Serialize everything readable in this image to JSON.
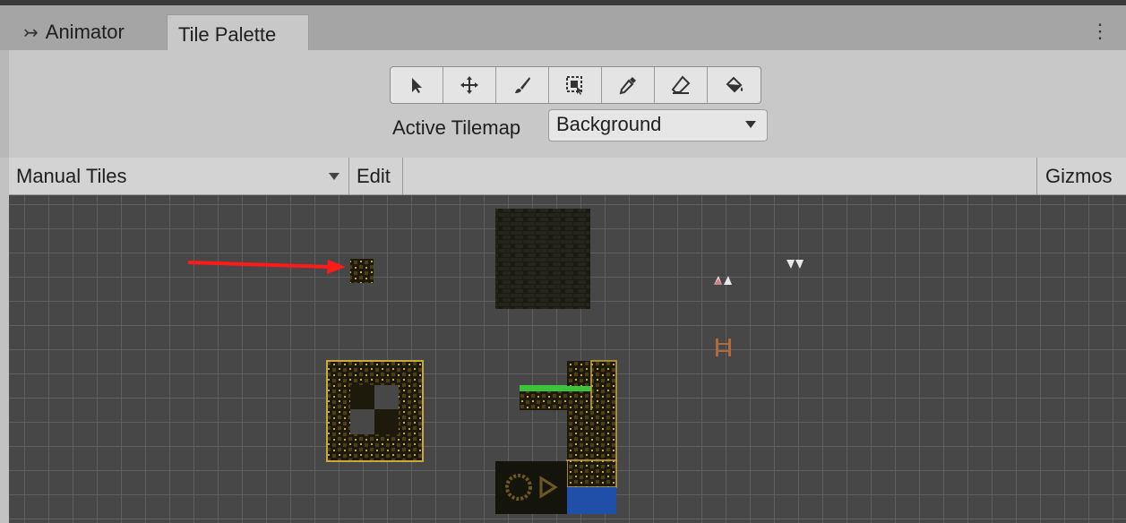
{
  "tabs": [
    {
      "label": "Animator",
      "icon": "animator-icon"
    },
    {
      "label": "Tile Palette",
      "active": true
    }
  ],
  "menu_icon": "kebab-menu-icon",
  "tools": [
    {
      "name": "select-tool",
      "icon": "arrow-icon"
    },
    {
      "name": "move-tool",
      "icon": "move-icon"
    },
    {
      "name": "paint-tool",
      "icon": "brush-icon"
    },
    {
      "name": "box-fill-tool",
      "icon": "box-select-icon"
    },
    {
      "name": "picker-tool",
      "icon": "eyedropper-icon"
    },
    {
      "name": "erase-tool",
      "icon": "eraser-icon"
    },
    {
      "name": "fill-tool",
      "icon": "paint-bucket-icon"
    }
  ],
  "active_tilemap": {
    "label": "Active Tilemap",
    "value": "Background"
  },
  "palette_bar": {
    "palette": "Manual Tiles",
    "edit": "Edit",
    "gizmos": "Gizmos"
  },
  "colors": {
    "annotation_arrow": "#ff1a1a",
    "grass": "#3dc23d",
    "water": "#1f4fa8",
    "tile_dark": "#1d1a0c",
    "tile_gold": "#c9a93a"
  }
}
